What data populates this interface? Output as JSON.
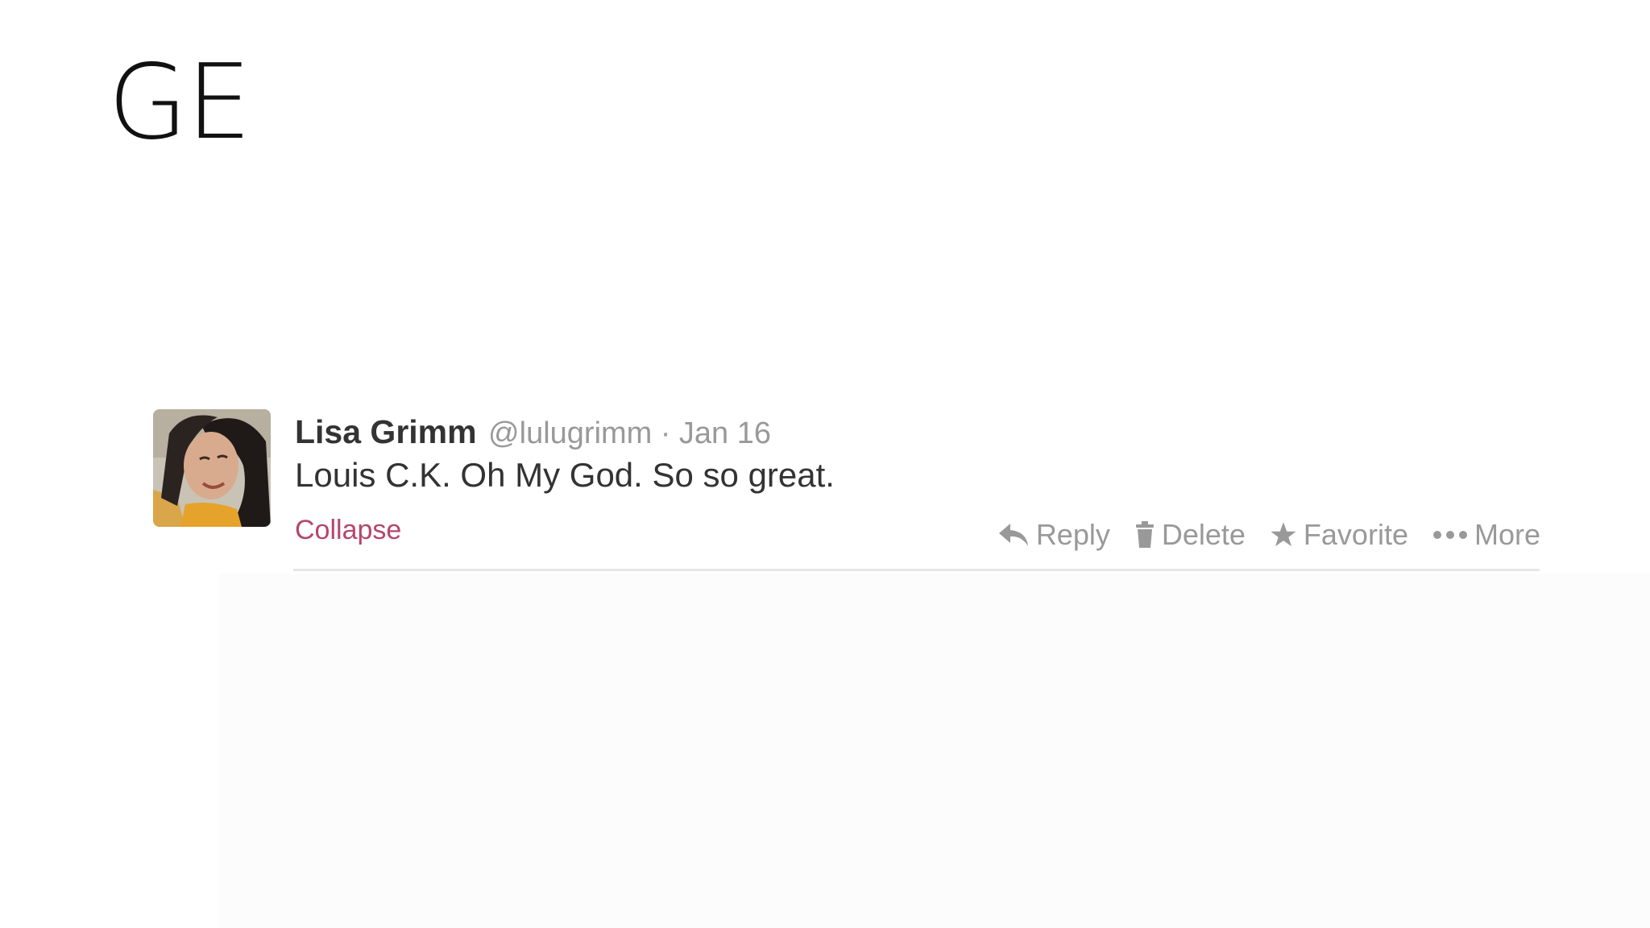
{
  "slide": {
    "title": "GE"
  },
  "tweet": {
    "fullname": "Lisa Grimm",
    "username": "@lulugrimm",
    "separator": "·",
    "timestamp": "Jan 16",
    "text": "Louis C.K. Oh My God. So so great.",
    "collapse_label": "Collapse",
    "actions": {
      "reply": {
        "label": "Reply",
        "icon": "reply-arrow-icon"
      },
      "delete": {
        "label": "Delete",
        "icon": "trash-icon"
      },
      "favorite": {
        "label": "Favorite",
        "icon": "star-icon"
      },
      "more": {
        "label": "More",
        "icon": "ellipsis-icon"
      }
    }
  },
  "colors": {
    "name": "#333333",
    "muted": "#999999",
    "link": "#b4476b",
    "divider": "#e6e6e6"
  }
}
